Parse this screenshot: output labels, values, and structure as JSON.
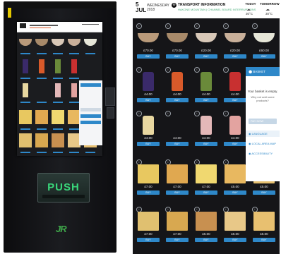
{
  "machine": {
    "push_label": "PUSH",
    "brand_logo": "JR"
  },
  "header": {
    "day": "5",
    "month": "JUL",
    "weekday": "WEDNESDAY",
    "year": "2018",
    "transport_title": "TRANSPORT INFORMATION",
    "transport_icon": "train-icon",
    "transport_subtitle": "HAKONE MOUNTAIN | CHANNEL BOARD INTERRUPTIONS",
    "today_label": "TODAY",
    "tomorrow_label": "TOMORROW",
    "today_temp": "30°C",
    "tomorrow_temp": "30°C",
    "weather_icon": "cloud-icon"
  },
  "buy_label": "BUY",
  "rows": [
    [
      {
        "price": "£70.00",
        "kind": "bowl",
        "color": "#b99a7a"
      },
      {
        "price": "£70.00",
        "kind": "bowl",
        "color": "#a88a6a"
      },
      {
        "price": "£20.00",
        "kind": "bowl",
        "color": "#d8c8b8"
      },
      {
        "price": "£20.00",
        "kind": "bowl",
        "color": "#c9b09a"
      },
      {
        "price": "£60.00",
        "kind": "bowl",
        "color": "#e6e6d8"
      }
    ],
    [
      {
        "price": "£4.00",
        "kind": "bottle",
        "color": "#3a2a6a"
      },
      {
        "price": "£4.00",
        "kind": "bottle",
        "color": "#d85a2a"
      },
      {
        "price": "£4.00",
        "kind": "bottle",
        "color": "#6a8a3a"
      },
      {
        "price": "£4.00",
        "kind": "bottle",
        "color": "#c83030"
      }
    ],
    [
      {
        "price": "£4.00",
        "kind": "bottle",
        "color": "#e8d7a0"
      },
      {
        "price": "£4.00",
        "kind": "empty",
        "color": "#151518"
      },
      {
        "price": "£4.00",
        "kind": "bottle",
        "color": "#e4b8b8"
      },
      {
        "price": "£4.00",
        "kind": "bottle",
        "color": "#e3a3a0"
      }
    ],
    [
      {
        "price": "£7.00",
        "kind": "pack",
        "color": "#e8c860"
      },
      {
        "price": "£7.00",
        "kind": "pack",
        "color": "#e0a850"
      },
      {
        "price": "£7.00",
        "kind": "pack",
        "color": "#f0d870"
      },
      {
        "price": "£5.00",
        "kind": "pack",
        "color": "#e8b860"
      },
      {
        "price": "£5.00",
        "kind": "pack",
        "color": "#e6c070"
      }
    ],
    [
      {
        "price": "£7.00",
        "kind": "pack",
        "color": "#e0c070"
      },
      {
        "price": "£7.00",
        "kind": "pack",
        "color": "#d8a850"
      },
      {
        "price": "£5.00",
        "kind": "pack",
        "color": "#c89050"
      },
      {
        "price": "£5.00",
        "kind": "pack",
        "color": "#e8c888"
      },
      {
        "price": "£5.00",
        "kind": "pack",
        "color": "#e8c070"
      }
    ]
  ],
  "basket": {
    "title": "BASKET",
    "empty_text": "Your basket is empty.",
    "sub_text": "Why not add some products?",
    "pay_label": "PAY NOW",
    "options": [
      "LANGUAGE",
      "LOCAL AREA MAP",
      "ACCESSIBILITY"
    ]
  },
  "colors": {
    "accent": "#2e88c9",
    "background": "#151518"
  }
}
